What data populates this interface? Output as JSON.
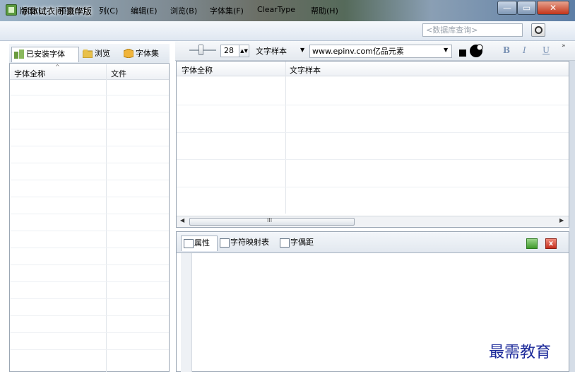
{
  "window": {
    "title": "字体试衣间 豪华版",
    "btn_min": "—",
    "btn_max": "▭",
    "btn_close": "✕"
  },
  "menu": {
    "items": [
      "版面(L)",
      "预览(V)",
      "列(C)",
      "编辑(E)",
      "浏览(B)",
      "字体集(F)",
      "ClearType",
      "帮助(H)"
    ]
  },
  "search": {
    "placeholder": "<数据库查询>"
  },
  "left_panel": {
    "tabs": [
      {
        "label": "已安装字体",
        "icon": "installed-fonts-icon"
      },
      {
        "label": "浏览",
        "icon": "folder-icon"
      },
      {
        "label": "字体集",
        "icon": "box-icon"
      }
    ],
    "columns": [
      "字体全称",
      "文件"
    ]
  },
  "toolbar": {
    "font_size": "28",
    "sample_mode": "文字样本",
    "sample_text": "www.epinv.com亿品元素",
    "bold": "B",
    "italic": "I",
    "underline": "U",
    "more": "»"
  },
  "right_list": {
    "columns": [
      "字体全称",
      "文字样本"
    ],
    "scroll_grip": "III"
  },
  "bottom_panel": {
    "tabs": [
      {
        "label": "属性",
        "icon": "properties-icon"
      },
      {
        "label": "字符映射表",
        "icon": "charmap-icon"
      },
      {
        "label": "字偶距",
        "icon": "kerning-icon"
      }
    ],
    "close": "x"
  },
  "watermark": {
    "text": "最需教育"
  },
  "colors": {
    "accent": "#5d7ea6",
    "watermark": "#1c2a9a",
    "close": "#c2351a",
    "export": "#3f9a2c"
  }
}
